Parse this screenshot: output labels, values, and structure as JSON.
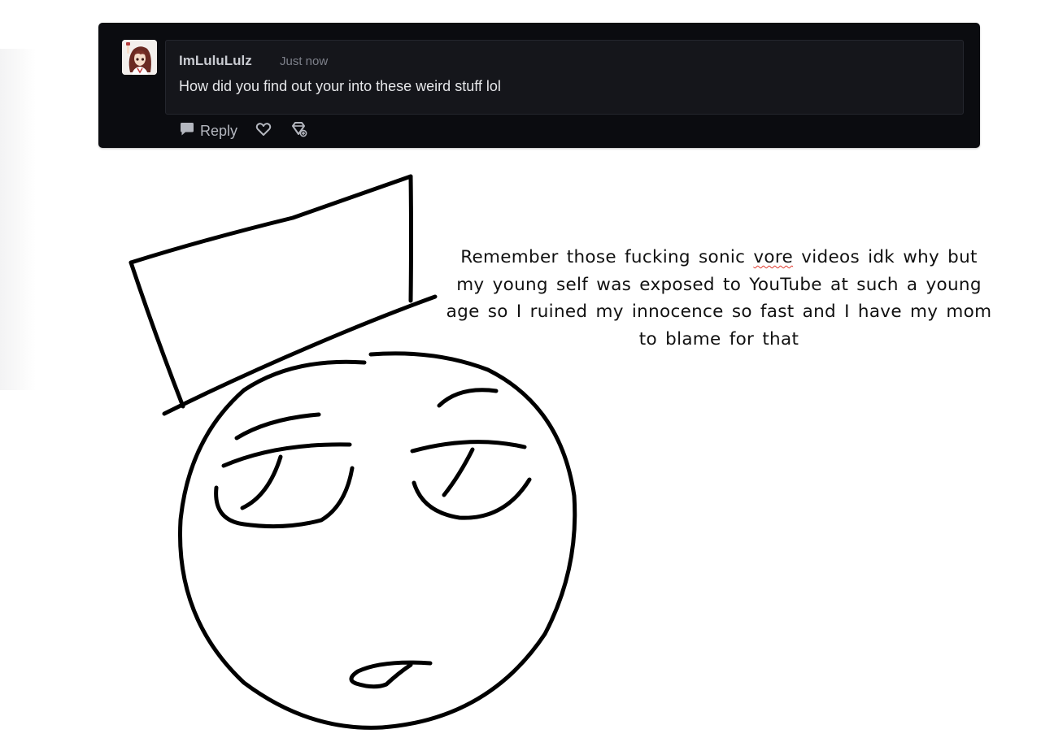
{
  "comment": {
    "username": "ImLuluLulz",
    "timestamp": "Just now",
    "text": "How did you find out your into these weird stuff lol",
    "reply_label": "Reply",
    "icons": {
      "reply": "speech-bubble-icon",
      "like": "heart-icon",
      "award": "award-icon"
    },
    "colors": {
      "card_bg": "#0b0c10",
      "bubble_bg": "#15161b",
      "username": "#c9cbd1",
      "text": "#e6e7ea",
      "muted": "#7d808a"
    }
  },
  "drawing": {
    "caption_parts": {
      "before_misspelled": "Remember those fucking sonic ",
      "misspelled_word": "vore",
      "after_misspelled": " videos idk why but my young self was exposed to YouTube at such a young age so I ruined my innocence so fast and I have my mom to blame for that"
    }
  }
}
